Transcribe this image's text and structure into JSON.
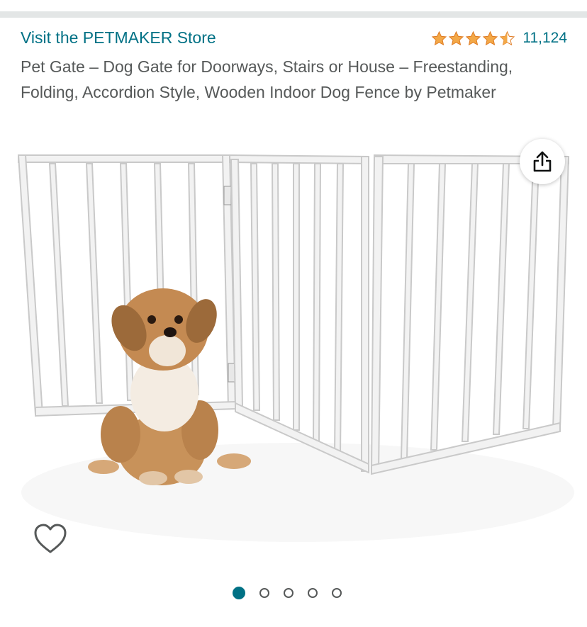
{
  "store": {
    "link_text": "Visit the PETMAKER Store"
  },
  "rating": {
    "stars": 4.5,
    "count": "11,124",
    "star_color": "#f3a847"
  },
  "product": {
    "title": "Pet Gate – Dog Gate for Doorways, Stairs or House – Freestanding, Folding, Accordion Style, Wooden Indoor Dog Fence by Petmaker"
  },
  "image": {
    "subject": "dog-and-gate"
  },
  "icons": {
    "share": "share-icon",
    "favorite": "heart-icon"
  },
  "carousel": {
    "total": 5,
    "active_index": 0
  },
  "colors": {
    "link": "#007185",
    "text": "#565959",
    "divider": "#e3e6e6"
  }
}
